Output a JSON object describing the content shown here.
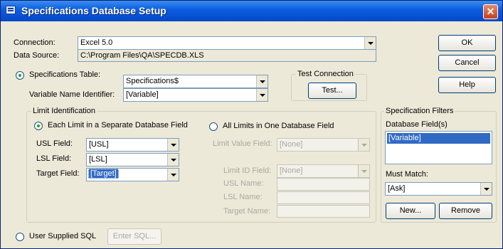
{
  "window": {
    "title": "Specifications Database Setup",
    "close_glyph": "✕"
  },
  "connection": {
    "label": "Connection:",
    "value": "Excel 5.0",
    "data_source_label": "Data Source:",
    "data_source_value": "C:\\Program Files\\QA\\SPECDB.XLS"
  },
  "buttons": {
    "ok": "OK",
    "cancel": "Cancel",
    "help": "Help",
    "test": "Test...",
    "new": "New...",
    "remove": "Remove",
    "enter_sql": "Enter SQL..."
  },
  "test_connection": {
    "label": "Test Connection"
  },
  "specs_table": {
    "radio_label": "Specifications Table:",
    "selected": true,
    "table_value": "Specifications$",
    "var_label": "Variable Name Identifier:",
    "var_value": "[Variable]"
  },
  "limit_id": {
    "group_label": "Limit Identification",
    "each_label": "Each Limit in a Separate Database Field",
    "all_label": "All Limits in One Database Field",
    "usl_label": "USL Field:",
    "usl_value": "[USL]",
    "lsl_label": "LSL Field:",
    "lsl_value": "[LSL]",
    "target_label": "Target Field:",
    "target_value": "[Target]",
    "limit_value_label": "Limit Value Field:",
    "limit_value_value": "[None]",
    "limit_id_label": "Limit ID Field:",
    "limit_id_value": "[None]",
    "usl_name_label": "USL Name:",
    "lsl_name_label": "LSL Name:",
    "target_name_label": "Target Name:"
  },
  "spec_filters": {
    "group_label": "Specification Filters",
    "db_fields_label": "Database Field(s)",
    "fields": [
      "[Variable]"
    ],
    "must_match_label": "Must Match:",
    "must_match_value": "[Ask]"
  },
  "user_sql": {
    "label": "User Supplied SQL"
  }
}
